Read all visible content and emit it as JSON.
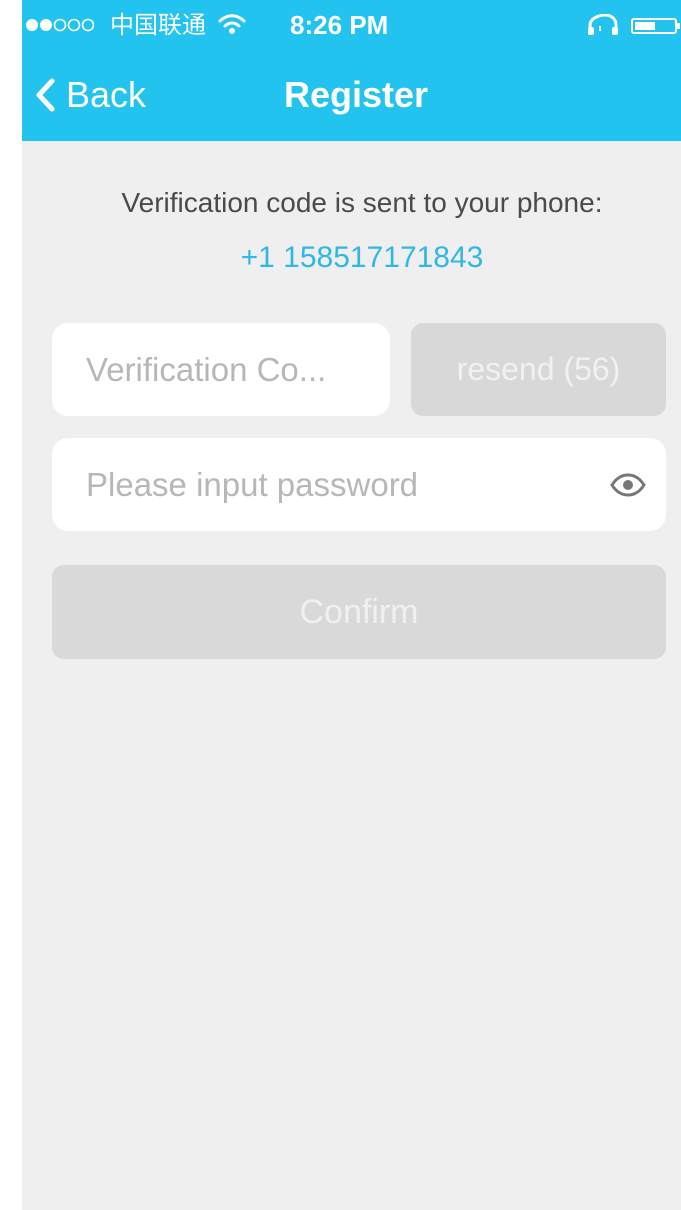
{
  "status_bar": {
    "carrier": "中国联通",
    "time": "8:26 PM",
    "icons": [
      "signal-dots-icon",
      "wifi-icon",
      "headphones-icon",
      "battery-icon"
    ]
  },
  "nav": {
    "back_label": "Back",
    "title": "Register",
    "back_icon": "chevron-left-icon"
  },
  "verification": {
    "message": "Verification code is sent to your phone:",
    "phone": "+1 158517171843"
  },
  "form": {
    "code_placeholder": "Verification Co...",
    "code_value": "",
    "resend_label": "resend (56)",
    "password_placeholder": "Please input password",
    "password_value": "",
    "show_password_icon": "eye-icon",
    "confirm_label": "Confirm"
  },
  "colors": {
    "header": "#22c3ef",
    "background": "#efefef",
    "phone_text": "#2fb7e6",
    "disabled_button": "#d9d9d9",
    "field": "#ffffff"
  }
}
